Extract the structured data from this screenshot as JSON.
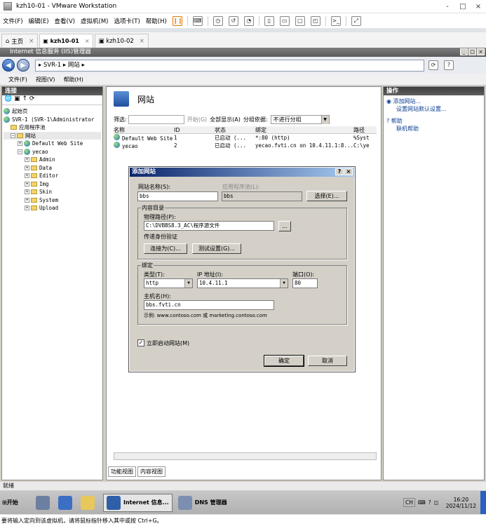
{
  "vm": {
    "title": "kzh10-01 - VMware Workstation",
    "menu": [
      "文件(F)",
      "编辑(E)",
      "查看(V)",
      "虚拟机(M)",
      "选项卡(T)",
      "帮助(H)"
    ],
    "tabs": [
      "主页",
      "kzh10-01",
      "kzh10-02"
    ],
    "controls": [
      "-",
      "□",
      "×"
    ]
  },
  "iis": {
    "title": "Internet 信息服务 (IIS)管理器",
    "address": "▸ SVR-1 ▸ 网站 ▸",
    "menu": [
      "文件(F)",
      "视图(V)",
      "帮助(H)"
    ]
  },
  "left": {
    "header": "连接",
    "tree": [
      {
        "indent": 0,
        "label": "起始页",
        "icon": "start-page-icon"
      },
      {
        "indent": 0,
        "label": "SVR-1 (SVR-1\\Administrator",
        "icon": "server-icon"
      },
      {
        "indent": 1,
        "label": "应用程序池",
        "icon": "app-pool-icon"
      },
      {
        "indent": 1,
        "label": "网站",
        "icon": "folder-icon"
      },
      {
        "indent": 2,
        "label": "Default Web Site",
        "icon": "globe-icon"
      },
      {
        "indent": 2,
        "label": "yecao",
        "icon": "globe-icon"
      },
      {
        "indent": 3,
        "label": "Admin",
        "icon": "folder-icon"
      },
      {
        "indent": 3,
        "label": "Data",
        "icon": "folder-icon"
      },
      {
        "indent": 3,
        "label": "Editor",
        "icon": "folder-icon"
      },
      {
        "indent": 3,
        "label": "Img",
        "icon": "folder-icon"
      },
      {
        "indent": 3,
        "label": "Skin",
        "icon": "folder-icon"
      },
      {
        "indent": 3,
        "label": "System",
        "icon": "folder-icon"
      },
      {
        "indent": 3,
        "label": "Upload",
        "icon": "folder-icon"
      }
    ]
  },
  "center": {
    "title": "网站",
    "filter_label": "筛选:",
    "go": "开始(G)",
    "show_all": "全部显示(A)",
    "group_label": "分组依据:",
    "group_value": "不进行分组",
    "columns": [
      "名称",
      "ID",
      "状态",
      "绑定",
      "路径"
    ],
    "rows": [
      [
        "Default Web Site",
        "1",
        "已启动 (...",
        "*:80 (http)",
        "%Syst"
      ],
      [
        "yecao",
        "2",
        "已启动 (...",
        "yecao.fvti.cn on 10.4.11.1:8...",
        "C:\\ye"
      ]
    ],
    "view_tabs": [
      "功能视图",
      "内容视图"
    ]
  },
  "right": {
    "header": "操作",
    "actions": [
      "添加网站...",
      "设置网站默认设置..."
    ],
    "help": [
      "帮助",
      "联机帮助"
    ]
  },
  "dialog": {
    "title": "添加网站",
    "help_btn": "?",
    "close_btn": "×",
    "site_name_label": "网站名称(S):",
    "site_name": "bbs",
    "pool_label": "应用程序池(L):",
    "pool": "bbs",
    "select_btn": "选择(E)...",
    "content_group": "内容目录",
    "path_label": "物理路径(P):",
    "path": "C:\\DVBBS8.3_AC\\程序源文件",
    "browse_btn": "...",
    "auth_label": "传递身份验证",
    "connect_btn": "连接为(C)...",
    "test_btn": "测试设置(G)...",
    "binding_group": "绑定",
    "type_label": "类型(T):",
    "type": "http",
    "ip_label": "IP 地址(I):",
    "ip": "10.4.11.1",
    "port_label": "端口(O):",
    "port": "80",
    "host_label": "主机名(H):",
    "host": "bbs.fvti.cn",
    "example": "示例: www.contoso.com 或 marketing.contoso.com",
    "start_label": "立即启动网站(M)",
    "ok": "确定",
    "cancel": "取消"
  },
  "status": "就绪",
  "taskbar": {
    "start": "开始",
    "items": [
      "Internet 信息...",
      "DNS 管理器"
    ],
    "ime": "CH",
    "time": "16:20",
    "date": "2024/11/12"
  },
  "bottom": "要将输入定向到该虚拟机，请将鼠标指针移入其中或按 Ctrl+G。"
}
